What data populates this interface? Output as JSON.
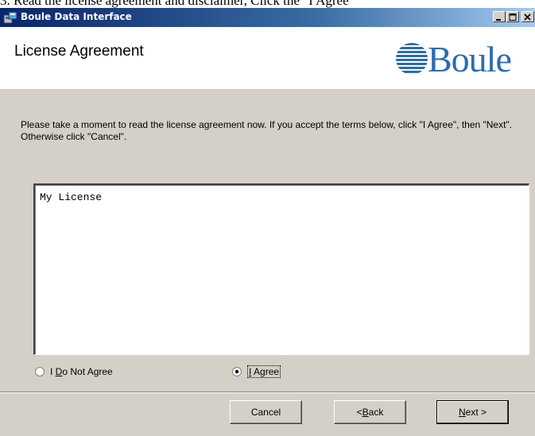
{
  "page_caption": "3. Read the license agreement and disclaimer, Click the \"I Agree\"",
  "window": {
    "title": "Boule Data Interface",
    "app_icon": "setup-icon",
    "controls": [
      "minimize-icon",
      "maximize-icon",
      "close-icon"
    ]
  },
  "header": {
    "title": "License Agreement",
    "logo_text": "Boule",
    "logo_color": "#2b6bb3"
  },
  "instructions": "Please take a moment to read the license agreement now. If you accept the terms below, click \"I Agree\", then \"Next\". Otherwise click \"Cancel\".",
  "license_text": "My License",
  "options": {
    "not_agree_prefix": "I ",
    "not_agree_mnemonic": "D",
    "not_agree_suffix": "o Not Agree",
    "agree_mnemonic": "I",
    "agree_suffix": " Agree",
    "selected": "agree"
  },
  "buttons": {
    "cancel": "Cancel",
    "back_prefix": "< ",
    "back_mnemonic": "B",
    "back_suffix": "ack",
    "next_mnemonic": "N",
    "next_suffix": "ext >"
  },
  "colors": {
    "title_bar_start": "#0a246a",
    "title_bar_end": "#a6caf0",
    "dialog_face": "#d4d0c8"
  }
}
